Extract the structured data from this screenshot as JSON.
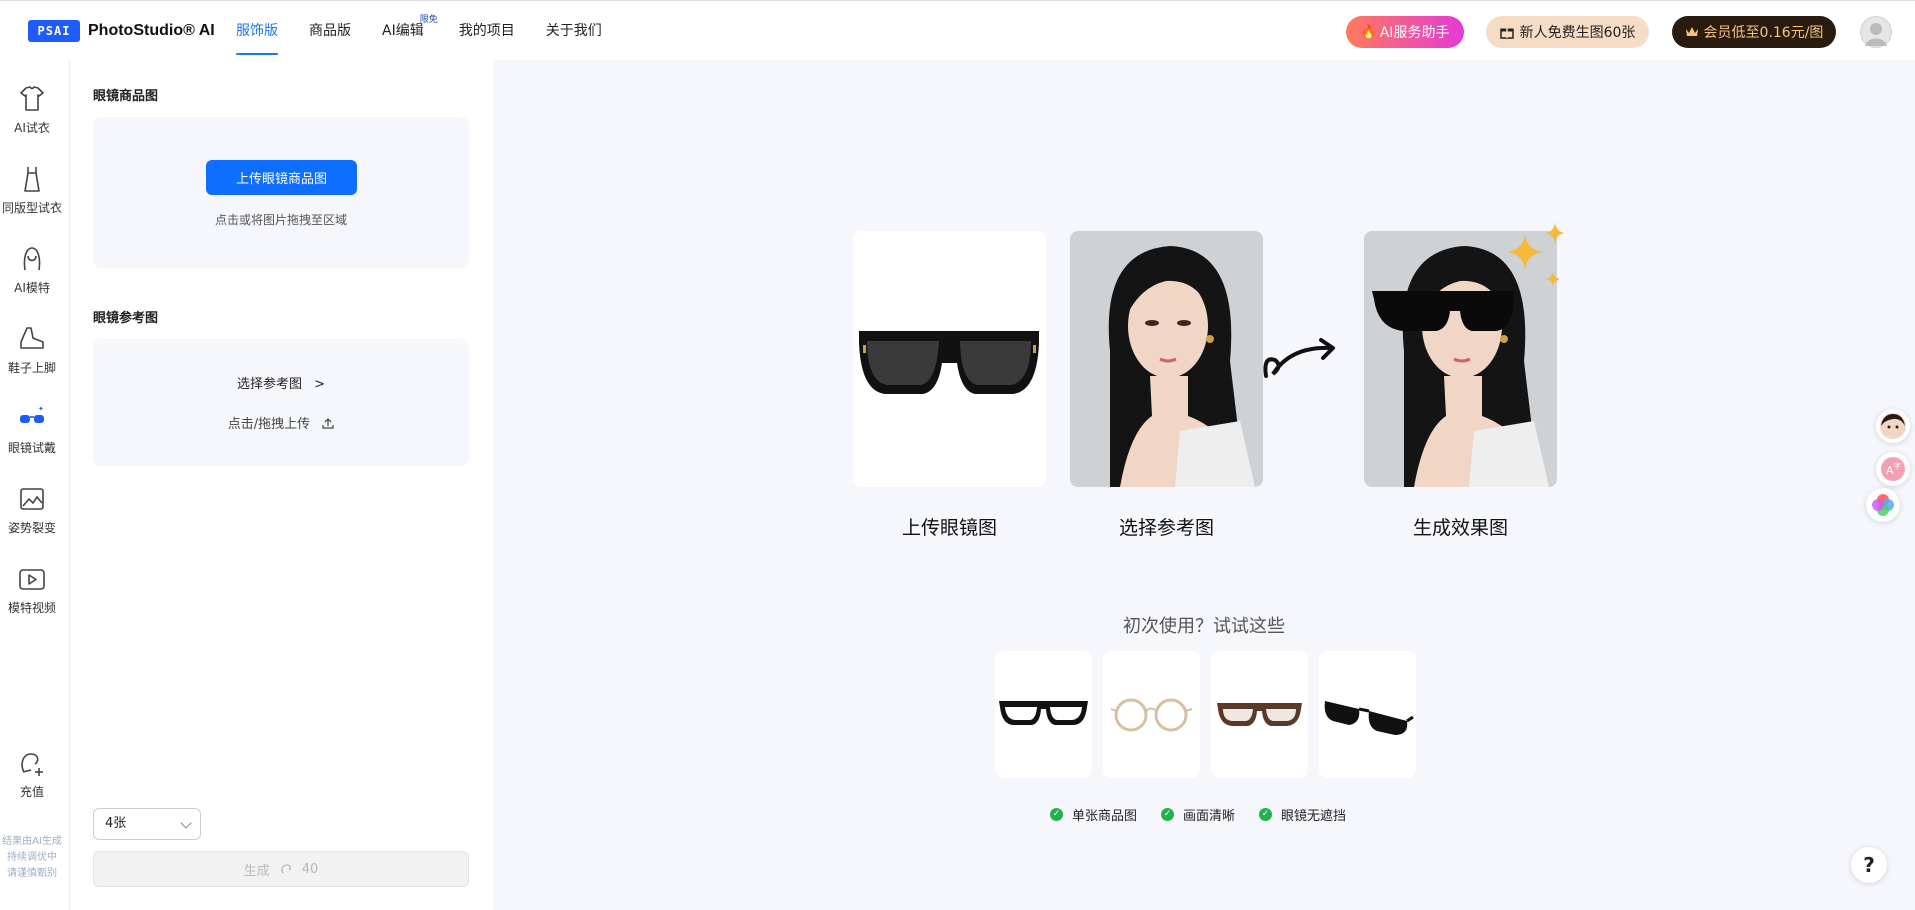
{
  "header": {
    "logo_badge": "PSAI",
    "logo_text": "PhotoStudio® AI",
    "nav": [
      {
        "label": "服饰版"
      },
      {
        "label": "商品版"
      },
      {
        "label": "AI编辑",
        "badge": "限免"
      },
      {
        "label": "我的项目"
      },
      {
        "label": "关于我们"
      }
    ],
    "assistant": "AI服务助手",
    "free_offer": "新人免费生图60张",
    "vip_offer": "会员低至0.16元/图"
  },
  "leftnav": {
    "items": [
      {
        "label": "AI试衣",
        "icon": "tshirt-icon"
      },
      {
        "label": "同版型试衣",
        "icon": "dress-icon"
      },
      {
        "label": "AI模特",
        "icon": "model-icon"
      },
      {
        "label": "鞋子上脚",
        "icon": "shoe-icon"
      },
      {
        "label": "眼镜试戴",
        "icon": "glasses-icon"
      },
      {
        "label": "姿势裂变",
        "icon": "pose-icon"
      },
      {
        "label": "模特视频",
        "icon": "video-icon"
      },
      {
        "label": "充值",
        "icon": "recharge-icon"
      }
    ],
    "note": [
      "结果由AI生成",
      "持续调优中",
      "请谨慎甄别"
    ]
  },
  "panel": {
    "product_title": "眼镜商品图",
    "upload_button": "上传眼镜商品图",
    "upload_hint": "点击或将图片拖拽至区域",
    "reference_title": "眼镜参考图",
    "reference_choose": "选择参考图",
    "reference_upload": "点击/拖拽上传",
    "count_select": "4张",
    "generate_label": "生成",
    "generate_cost": "40"
  },
  "main": {
    "steps": [
      "上传眼镜图",
      "选择参考图",
      "生成效果图"
    ],
    "try_title": "初次使用？试试这些",
    "checks": [
      "单张商品图",
      "画面清晰",
      "眼镜无遮挡"
    ]
  },
  "colors": {
    "primary": "#0d6eff",
    "main_bg": "#f5f7fd",
    "success": "#22b14c"
  }
}
